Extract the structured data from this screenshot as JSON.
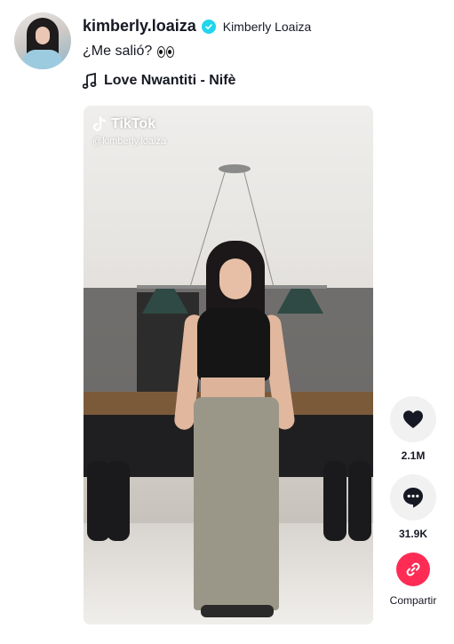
{
  "author": {
    "username": "kimberly.loaiza",
    "nickname": "Kimberly Loaiza",
    "verified_icon": "verified-badge-icon"
  },
  "post": {
    "caption": "¿Me salió?",
    "caption_emoji": "eyes-emoji",
    "music": "Love Nwantiti - Nifè"
  },
  "video": {
    "watermark_brand": "TikTok",
    "watermark_user": "@kimberly.loaiza"
  },
  "actions": {
    "like_count": "2.1M",
    "comment_count": "31.9K",
    "share_label": "Compartir"
  },
  "colors": {
    "verified": "#20d5ec",
    "share": "#fe2c55",
    "action_bg": "#f1f1f2",
    "text": "#161823"
  }
}
